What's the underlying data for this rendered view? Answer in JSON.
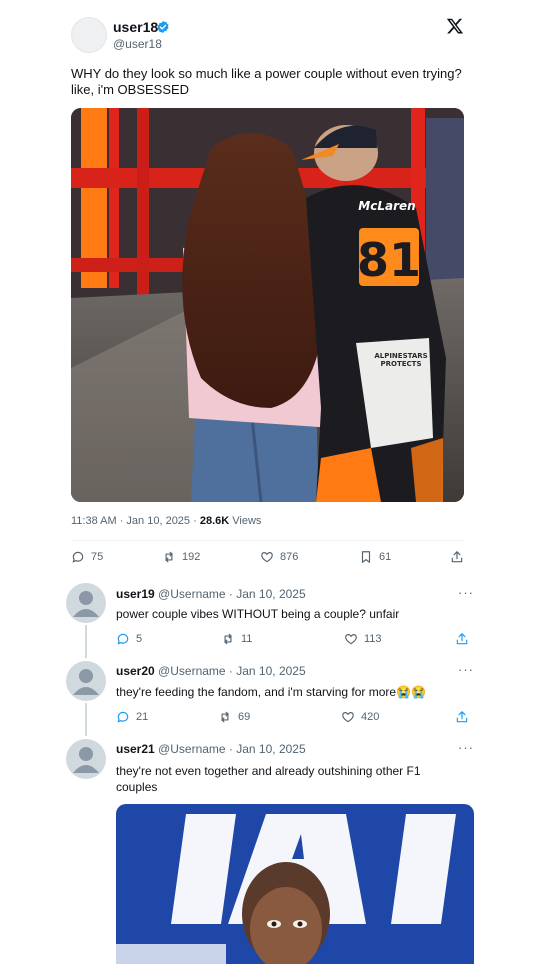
{
  "tweet": {
    "username": "user18",
    "handle": "@user18",
    "text_line1": "WHY do they look so much like a power couple without even trying?",
    "text_line2": "like, i'm OBSESSED",
    "time": "11:38 AM · Jan 10, 2025 · ",
    "views_count": "28.6K",
    "views_label": " Views",
    "stats": {
      "replies": "75",
      "retweets": "192",
      "likes": "876",
      "bookmarks": "61"
    },
    "photo_texts": {
      "brand": "McLaren",
      "number": "81",
      "suit_patch_1": "ALPINESTARS",
      "suit_patch_2": "PROTECTS"
    }
  },
  "replies": [
    {
      "username": "user19",
      "meta": "@Username · Jan 10, 2025",
      "text": "power couple vibes WITHOUT being a couple? unfair",
      "replies": "5",
      "retweets": "11",
      "likes": "113"
    },
    {
      "username": "user20",
      "meta": "@Username · Jan 10, 2025",
      "text": "they're feeding the fandom, and i'm starving for more😭😭",
      "replies": "21",
      "retweets": "69",
      "likes": "420"
    },
    {
      "username": "user21",
      "meta": "@Username · Jan 10, 2025",
      "text_line1": "they're not even together and already outshining other F1",
      "text_line2": "couples"
    }
  ],
  "more_label": "···",
  "colors": {
    "accent": "#1d9bf0",
    "text": "#0f1419",
    "secondary": "#536471",
    "mclaren_orange": "#ff8000"
  }
}
